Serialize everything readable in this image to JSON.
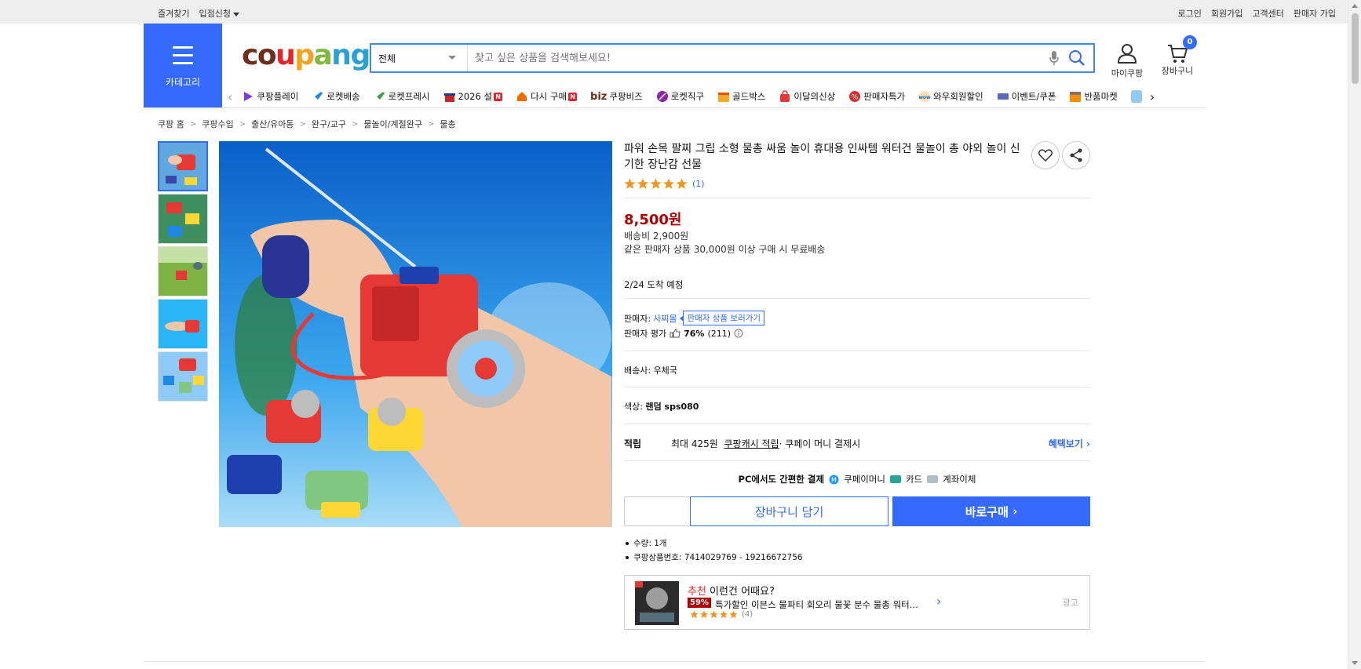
{
  "topbar": {
    "left": [
      "즐겨찾기",
      "입점신청"
    ],
    "right": [
      "로그인",
      "회원가입",
      "고객센터",
      "판매자 가입"
    ]
  },
  "header": {
    "category_label": "카테고리",
    "logo": "coupang",
    "search": {
      "scope": "전체",
      "placeholder": "찾고 싶은 상품을 검색해보세요!"
    },
    "mycoupang": "마이쿠팡",
    "cart": "장바구니",
    "cart_count": "0"
  },
  "quicknav": [
    {
      "label": "쿠팡플레이",
      "icon": "play-icon",
      "color": "#7c3aed"
    },
    {
      "label": "로켓배송",
      "icon": "rocket-icon",
      "color": "#1e88e5"
    },
    {
      "label": "로켓프레시",
      "icon": "rocket-fresh-icon",
      "color": "#43a047"
    },
    {
      "label": "2026 설",
      "icon": "gift-icon",
      "color": "#c62828",
      "new": "N"
    },
    {
      "label": "다시 구매",
      "icon": "repurchase-icon",
      "color": "#ef6c00",
      "new": "N"
    },
    {
      "label": "쿠팡비즈",
      "prefix": "biz",
      "icon": "biz-icon"
    },
    {
      "label": "로켓직구",
      "icon": "global-icon",
      "color": "#8e24aa"
    },
    {
      "label": "골드박스",
      "icon": "goldbox-icon",
      "color": "#f9a825"
    },
    {
      "label": "이달의신상",
      "icon": "newbag-icon",
      "color": "#e53935"
    },
    {
      "label": "판매자특가",
      "icon": "percent-icon",
      "color": "#d32f2f"
    },
    {
      "label": "와우회원할인",
      "icon": "wow-icon",
      "color": "#ff7043"
    },
    {
      "label": "이벤트/쿠폰",
      "icon": "coupon-icon",
      "color": "#5c6bc0"
    },
    {
      "label": "반품마켓",
      "icon": "market-icon",
      "color": "#fb8c00"
    }
  ],
  "breadcrumb": [
    "쿠팡 홈",
    "쿠팡수입",
    "출산/유아동",
    "완구/교구",
    "물놀이/계절완구",
    "물총"
  ],
  "product": {
    "title": "파워 손목 팔찌 그립 소형 물총 싸움 놀이 휴대용 인싸템 워터건 물놀이 총 야외 놀이 신기한 장난감 선물",
    "review_count": "(1)",
    "price": "8,500원",
    "shipping_fee": "배송비 2,900원",
    "shipping_note": "같은 판매자 상품 30,000원 이상 구매 시 무료배송",
    "arrival": "2/24 도착 예정",
    "seller_label": "판매자:",
    "seller_name": "사찌몰",
    "seller_link": "판매자 상품 보러가기",
    "seller_rating_label": "판매자 평가",
    "seller_rating": "76%",
    "seller_rating_count": "(211)",
    "carrier": "배송사:  우체국",
    "color_label": "색상:",
    "color_value": "랜덤 sps080",
    "points_label": "적립",
    "points_pre": "최대 425원",
    "points_link": "쿠팡캐시 적립",
    "points_post": " · 쿠페이 머니 결제시",
    "points_more": "혜택보기",
    "pc_pay": "PC에서도 간편한 결제",
    "pay_methods": [
      "쿠페이머니",
      "카드",
      "계좌이체"
    ],
    "quantity": "1",
    "cart_button": "장바구니 담기",
    "buy_button": "바로구매",
    "meta": [
      "수량: 1개",
      "쿠팡상품번호: 7414029769 - 19216672756"
    ]
  },
  "recommend": {
    "heading_red": "추천",
    "heading": " 이런건 어때요?",
    "discount": "59%",
    "name": "특가할인 이븐스 물파티 회오리 물꽃 분수 물총 워터...",
    "review_count": "(4)",
    "ad": "광고"
  },
  "colors": {
    "accent": "#346aff",
    "price": "#ae0000",
    "star": "#f7941d"
  }
}
